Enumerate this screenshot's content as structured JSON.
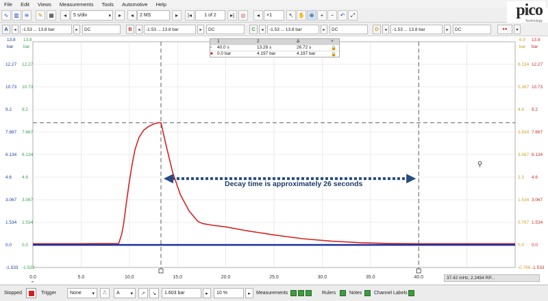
{
  "menu": [
    "File",
    "Edit",
    "Views",
    "Measurements",
    "Tools",
    "Automotive",
    "Help"
  ],
  "logo": {
    "word": "pico",
    "sub": "Technology"
  },
  "toolbar": {
    "timebase": "5 s/div",
    "samples": "2 MS",
    "buffer": "1 of 2",
    "zoom": "×1"
  },
  "channels": [
    {
      "letter": "A",
      "range": "-1.53 ... 13.8 bar",
      "coupling": "DC",
      "color": "#1a3fa8"
    },
    {
      "letter": "B",
      "range": "-1.53 ... 13.8 bar",
      "coupling": "DC",
      "color": "#cc2a2a"
    },
    {
      "letter": "C",
      "range": "-1.53 ... 13.8 bar",
      "coupling": "DC",
      "color": "#3aa24a"
    },
    {
      "letter": "D",
      "range": "-1.53 ... 13.8 bar",
      "coupling": "DC",
      "color": "#c9a227"
    }
  ],
  "axes": {
    "left_top_a": "13.8",
    "left_top_c": "13.8",
    "unit_left_a": "bar",
    "unit_left_c": "bar",
    "right_top_d": "6.9",
    "right_top_b": "13.8",
    "unit_right_d": "bar",
    "unit_right_b": "bar",
    "left_ticks": [
      "12.27",
      "10.73",
      "9.2",
      "7.667",
      "6.134",
      "4.6",
      "3.067",
      "1.534",
      "0.0",
      "-1.533"
    ],
    "right_ticks_d": [
      "6.134",
      "5.367",
      "4.6",
      "3.834",
      "3.067",
      "2.3",
      "1.534",
      "0.767",
      "0.0",
      "-0.766"
    ],
    "right_ticks_b": [
      "12.27",
      "10.73",
      "9.2",
      "7.667",
      "6.134",
      "4.6",
      "3.067",
      "1.534",
      "0.0",
      "-1.533"
    ],
    "x_ticks": [
      "0.0",
      "5.0",
      "10.0",
      "15.0",
      "20.0",
      "25.0",
      "30.0",
      "35.0",
      "40.0",
      "45.0",
      "50.0"
    ],
    "x_unit": "s",
    "rulers": [
      "1",
      "2"
    ]
  },
  "measurements": {
    "headers": [
      "1",
      "2",
      "Δ"
    ],
    "rows": [
      [
        "40.0 s",
        "13.28 s",
        "26.72 s"
      ],
      [
        "0.0 bar",
        "4.197 bar",
        "4.197 bar"
      ]
    ]
  },
  "annotation": "Decay time is approximately 26 seconds",
  "freq_readout": "37.42 mHz, 2.2454 RP...",
  "status": {
    "state": "Stopped",
    "trigger_label": "Trigger",
    "trigger_mode": "None",
    "trigger_channel": "A",
    "trigger_level": "1.603 bar",
    "pretrigger": "10 %",
    "measurements_label": "Measurements",
    "rulers_label": "Rulers",
    "notes_label": "Notes",
    "channel_labels_label": "Channel Labels"
  },
  "chart_data": {
    "type": "line",
    "xlim": [
      0,
      50
    ],
    "ylim": [
      -1.533,
      13.8
    ],
    "series": [
      {
        "name": "B",
        "color": "#d62020",
        "x": [
          0,
          5,
          8.9,
          9.2,
          9.4,
          9.7,
          10.0,
          10.3,
          10.6,
          11.0,
          11.5,
          12.0,
          12.5,
          13.0,
          13.28,
          13.8,
          14.5,
          15.3,
          16.2,
          17.1,
          17.6,
          18.5,
          20,
          22,
          25,
          28,
          31,
          34,
          37,
          40,
          45,
          50
        ],
        "y": [
          0.08,
          0.08,
          0.1,
          0.7,
          1.4,
          2.9,
          4.3,
          5.5,
          6.5,
          7.3,
          7.8,
          8.05,
          8.2,
          8.3,
          8.3,
          6.8,
          4.9,
          3.4,
          2.3,
          1.6,
          1.45,
          1.35,
          1.22,
          0.98,
          0.68,
          0.42,
          0.25,
          0.15,
          0.1,
          0.08,
          0.08,
          0.08
        ]
      },
      {
        "name": "A",
        "color": "#1a2fa0",
        "x": [
          0,
          50
        ],
        "y": [
          0.0,
          0.0
        ]
      }
    ],
    "cursors": {
      "vertical": [
        13.28,
        40.0
      ],
      "horizontal": [
        8.3
      ]
    }
  }
}
